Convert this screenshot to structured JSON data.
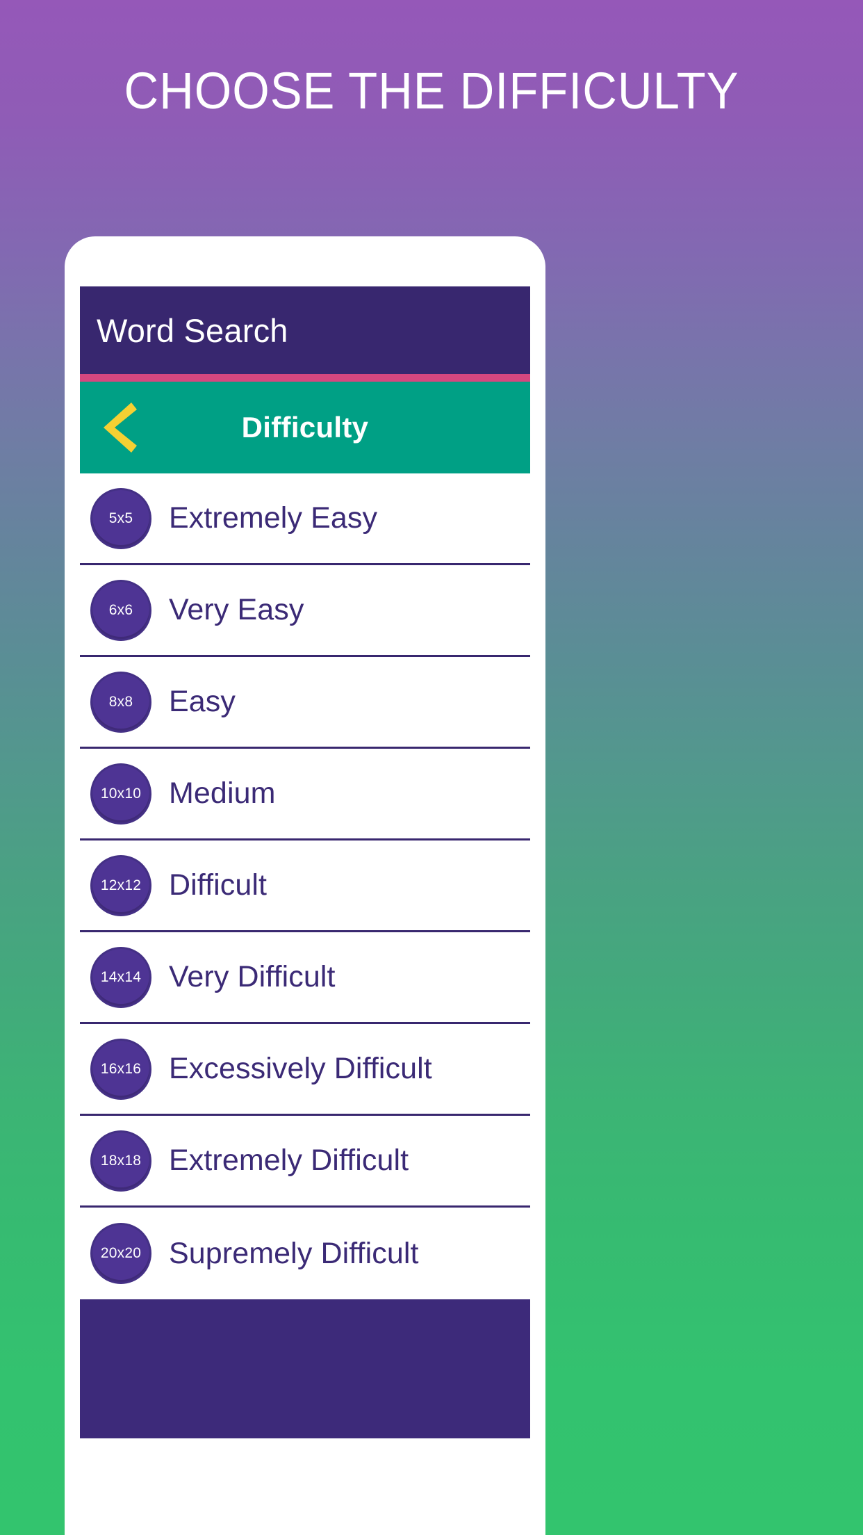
{
  "promo": {
    "headline": "CHOOSE THE DIFFICULTY"
  },
  "colors": {
    "bg_gradient_top": "#9558b8",
    "bg_gradient_bottom": "#33c46e",
    "appbar": "#38276f",
    "accent_stripe": "#d6477f",
    "subheader": "#00a085",
    "back_chevron": "#f5d033",
    "badge": "#4e3494",
    "label_text": "#3b2a76",
    "bottom_block": "#3d2a7a"
  },
  "app": {
    "title": "Word Search",
    "subheader": {
      "back_icon": "chevron-left-icon",
      "title": "Difficulty"
    }
  },
  "difficulties": [
    {
      "size": "5x5",
      "label": "Extremely Easy"
    },
    {
      "size": "6x6",
      "label": "Very Easy"
    },
    {
      "size": "8x8",
      "label": "Easy"
    },
    {
      "size": "10x10",
      "label": "Medium"
    },
    {
      "size": "12x12",
      "label": "Difficult"
    },
    {
      "size": "14x14",
      "label": "Very Difficult"
    },
    {
      "size": "16x16",
      "label": "Excessively Difficult"
    },
    {
      "size": "18x18",
      "label": "Extremely Difficult"
    },
    {
      "size": "20x20",
      "label": "Supremely Difficult"
    }
  ]
}
